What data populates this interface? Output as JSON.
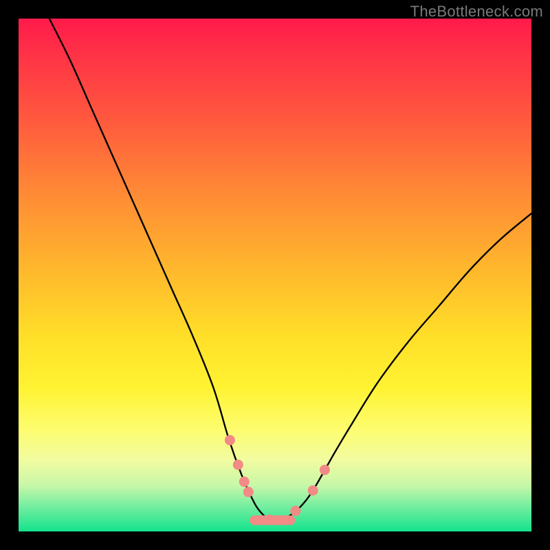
{
  "watermark": "TheBottleneck.com",
  "chart_data": {
    "type": "line",
    "title": "",
    "xlabel": "",
    "ylabel": "",
    "xlim": [
      0,
      100
    ],
    "ylim": [
      0,
      100
    ],
    "grid": false,
    "series": [
      {
        "name": "bottleneck-curve",
        "color": "#000000",
        "x": [
          6,
          10,
          14,
          18,
          22,
          26,
          30,
          34,
          38,
          41,
          43.5,
          45.5,
          47,
          49,
          51,
          53.5,
          56,
          58,
          60,
          62,
          65,
          70,
          76,
          82,
          88,
          94,
          100
        ],
        "y": [
          100,
          92,
          83,
          74,
          65,
          56,
          47,
          38,
          28,
          18,
          11,
          6.5,
          4,
          2.3,
          2.3,
          3.5,
          6,
          9,
          12.5,
          16,
          21,
          29,
          37,
          44,
          51,
          57,
          62
        ]
      },
      {
        "name": "highlight-points",
        "color": "#f28a86",
        "type": "scatter",
        "points": [
          {
            "x": 41.2,
            "y": 17.8
          },
          {
            "x": 42.8,
            "y": 13.0
          },
          {
            "x": 44.0,
            "y": 9.7
          },
          {
            "x": 44.8,
            "y": 7.7
          },
          {
            "x": 49.0,
            "y": 2.3
          },
          {
            "x": 54.0,
            "y": 4.0
          },
          {
            "x": 57.4,
            "y": 8.0
          },
          {
            "x": 59.7,
            "y": 12.0
          }
        ]
      },
      {
        "name": "highlight-segment",
        "color": "#f28a86",
        "type": "line",
        "x": [
          46,
          53
        ],
        "y": [
          2.2,
          2.2
        ]
      }
    ]
  }
}
